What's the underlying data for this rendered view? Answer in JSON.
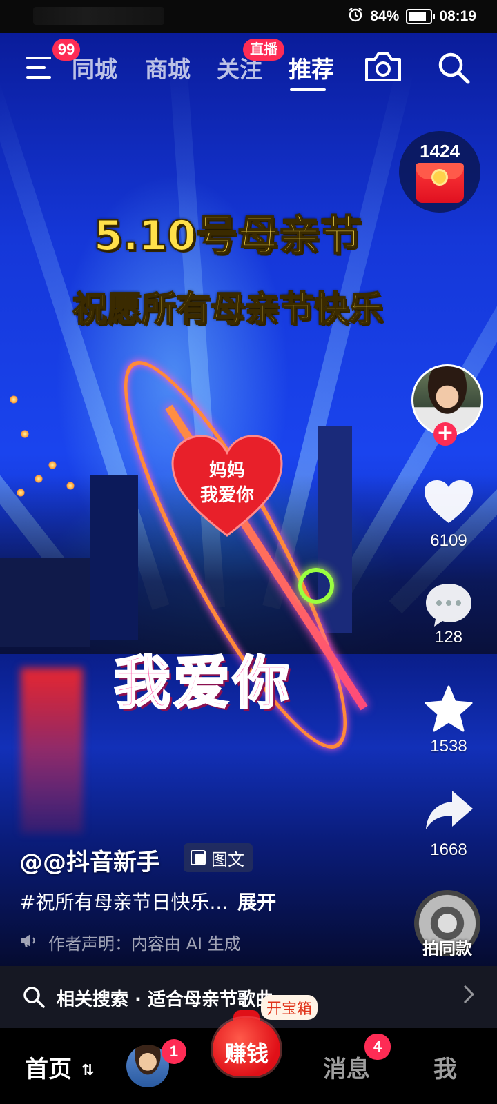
{
  "status_bar": {
    "battery": "84%",
    "time": "08:19",
    "battery_level": 0.84
  },
  "top_nav": {
    "menu_badge": "99",
    "tabs": [
      {
        "label": "同城",
        "active": false
      },
      {
        "label": "商城",
        "active": false
      },
      {
        "label": "关注",
        "active": false,
        "badge": "直播"
      },
      {
        "label": "推荐",
        "active": true
      }
    ]
  },
  "video": {
    "title_line1": "5.10号母亲节",
    "title_line2": "祝愿所有母亲节快乐",
    "heart_text": "妈妈\n我爱你",
    "overlay_text": "我爱你"
  },
  "right_rail": {
    "red_packet_count": "1424",
    "likes": "6109",
    "comments": "128",
    "favorites": "1538",
    "shares": "1668",
    "same_style_label": "拍同款"
  },
  "caption": {
    "author": "@@抖音新手",
    "tag": "图文",
    "description": "#祝所有母亲节日快乐...",
    "expand": "展开",
    "ai_notice": "作者声明：内容由 AI 生成"
  },
  "related_search": {
    "text": "相关搜索 · 适合母亲节歌曲"
  },
  "bottom_tabs": {
    "home": "首页",
    "friends_badge": "1",
    "earn": "赚钱",
    "earn_chip": "开宝箱",
    "messages": "消息",
    "messages_badge": "4",
    "me": "我"
  }
}
